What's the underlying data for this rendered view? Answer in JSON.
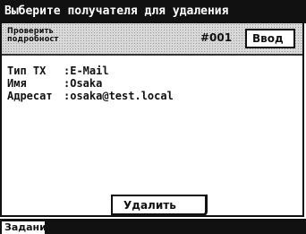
{
  "window": {
    "title": "Выберите получателя для удаления"
  },
  "header": {
    "check_details_label": "Проверить\nподробност",
    "job_number": "#001",
    "enter_button_label": "Ввод"
  },
  "details": {
    "rows": [
      {
        "key": "Тип ТХ",
        "sep": ":",
        "value": "E-Mail"
      },
      {
        "key": "Имя",
        "sep": ":",
        "value": "Osaka"
      },
      {
        "key": "Адресат",
        "sep": ":",
        "value": "osaka@test.local"
      }
    ]
  },
  "actions": {
    "delete_button_label": "Удалить"
  },
  "tabs": {
    "jobs_label": "Задания"
  }
}
